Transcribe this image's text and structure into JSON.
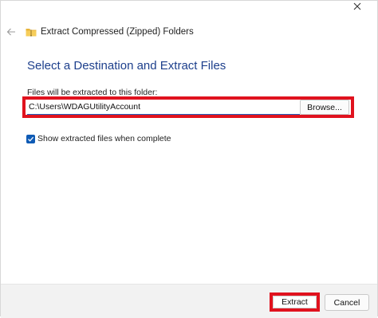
{
  "window": {
    "close_icon": "close-icon"
  },
  "header": {
    "back_icon": "back-arrow-icon",
    "folder_icon": "zipped-folder-icon",
    "title": "Extract Compressed (Zipped) Folders"
  },
  "main": {
    "heading": "Select a Destination and Extract Files",
    "folder_label": "Files will be extracted to this folder:",
    "path_value": "C:\\Users\\WDAGUtilityAccount",
    "browse_label": "Browse...",
    "show_files_label": "Show extracted files when complete",
    "show_files_checked": true
  },
  "footer": {
    "extract_label": "Extract",
    "cancel_label": "Cancel"
  },
  "colors": {
    "heading": "#1d3f8c",
    "checkbox": "#0f5bb5",
    "highlight": "#e0121e"
  }
}
